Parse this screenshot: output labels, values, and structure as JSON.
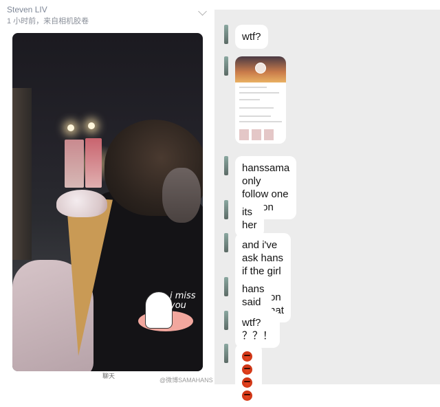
{
  "post": {
    "author": "Steven LIV",
    "meta": "1 小时前，来自相机胶卷"
  },
  "photo": {
    "sticker_text": "i miss\nyou"
  },
  "footer": {
    "page_label": "聊天",
    "watermark": "@微博SAMAHANS"
  },
  "chat": {
    "messages": [
      {
        "type": "text",
        "text": "wtf?"
      },
      {
        "type": "image"
      },
      {
        "type": "text",
        "text": "hanssama only follow one\nperson"
      },
      {
        "type": "text",
        "text": "its her"
      },
      {
        "type": "text",
        "text": "and i've ask hans if the girl is\nhis gf on snapchat"
      },
      {
        "type": "text",
        "text": "hans said yes"
      },
      {
        "type": "text",
        "text": "wtf? ？？！"
      },
      {
        "type": "emoji",
        "icon": "angry-face-emoji",
        "count": 4
      }
    ]
  },
  "colors": {
    "chat_background": "#ececec",
    "bubble": "#ffffff",
    "author": "#7d8696"
  }
}
